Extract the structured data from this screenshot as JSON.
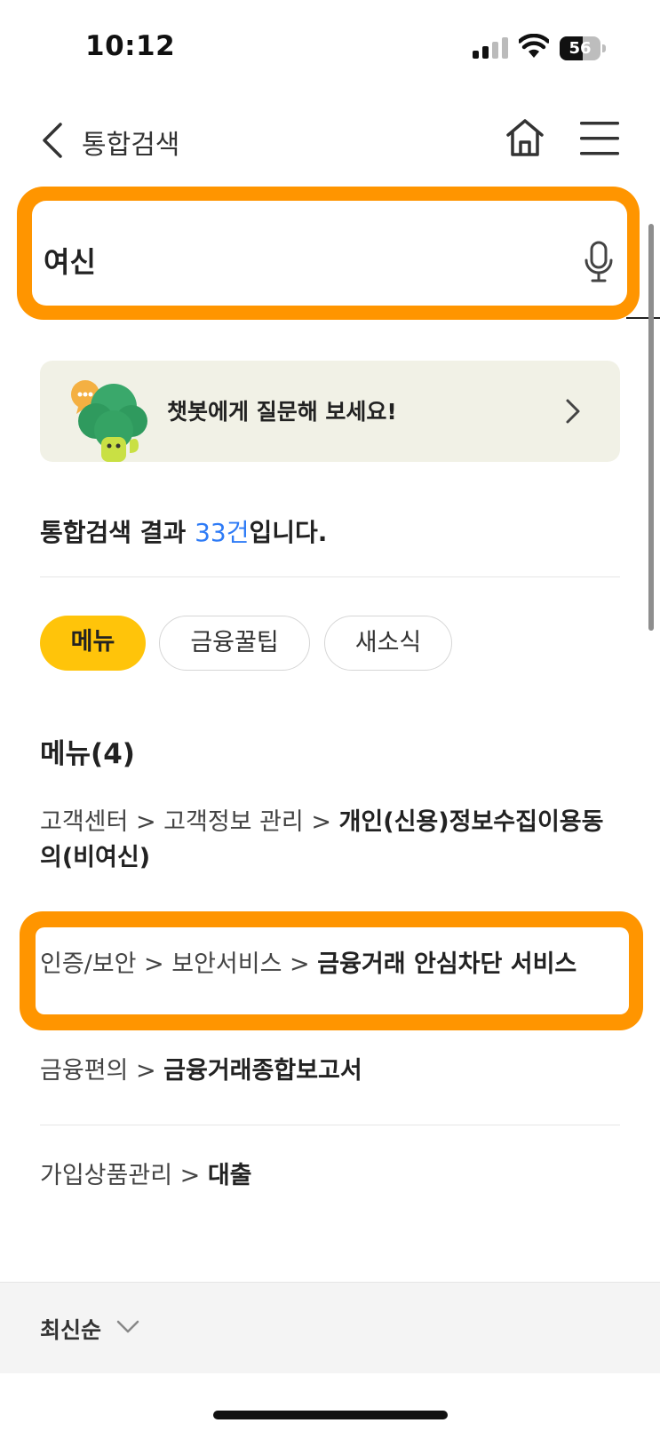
{
  "status_bar": {
    "time": "10:12",
    "battery": "56",
    "battery_level": 0.56
  },
  "header": {
    "title": "통합검색"
  },
  "search": {
    "value": "여신"
  },
  "chatbot": {
    "text": "챗봇에게 질문해 보세요!"
  },
  "results": {
    "prefix": "통합검색 결과 ",
    "count": "33건",
    "suffix": "입니다."
  },
  "tabs": [
    {
      "label": "메뉴",
      "active": true
    },
    {
      "label": "금융꿀팁",
      "active": false
    },
    {
      "label": "새소식",
      "active": false
    }
  ],
  "menu_section": {
    "title": "메뉴(4)",
    "items": [
      {
        "path": "고객센터 > 고객정보 관리 > ",
        "name_line1": "개인(신용)정보수집이용동",
        "name_line2_a": "의(비",
        "name_line2_highlight": "여신",
        "name_line2_b": ")"
      },
      {
        "path": "인증/보안 > 보안서비스 > ",
        "name": "금융거래 안심차단 서비스"
      },
      {
        "path": "금융편의 > ",
        "name": "금융거래종합보고서"
      },
      {
        "path": "가입상품관리 > ",
        "name": "대출"
      }
    ]
  },
  "sort": {
    "label": "최신순"
  },
  "colors": {
    "accent_orange": "#ff9500",
    "chip_yellow": "#ffc40a",
    "link_blue": "#2e7bf6",
    "banner_bg": "#f1f1e6"
  }
}
